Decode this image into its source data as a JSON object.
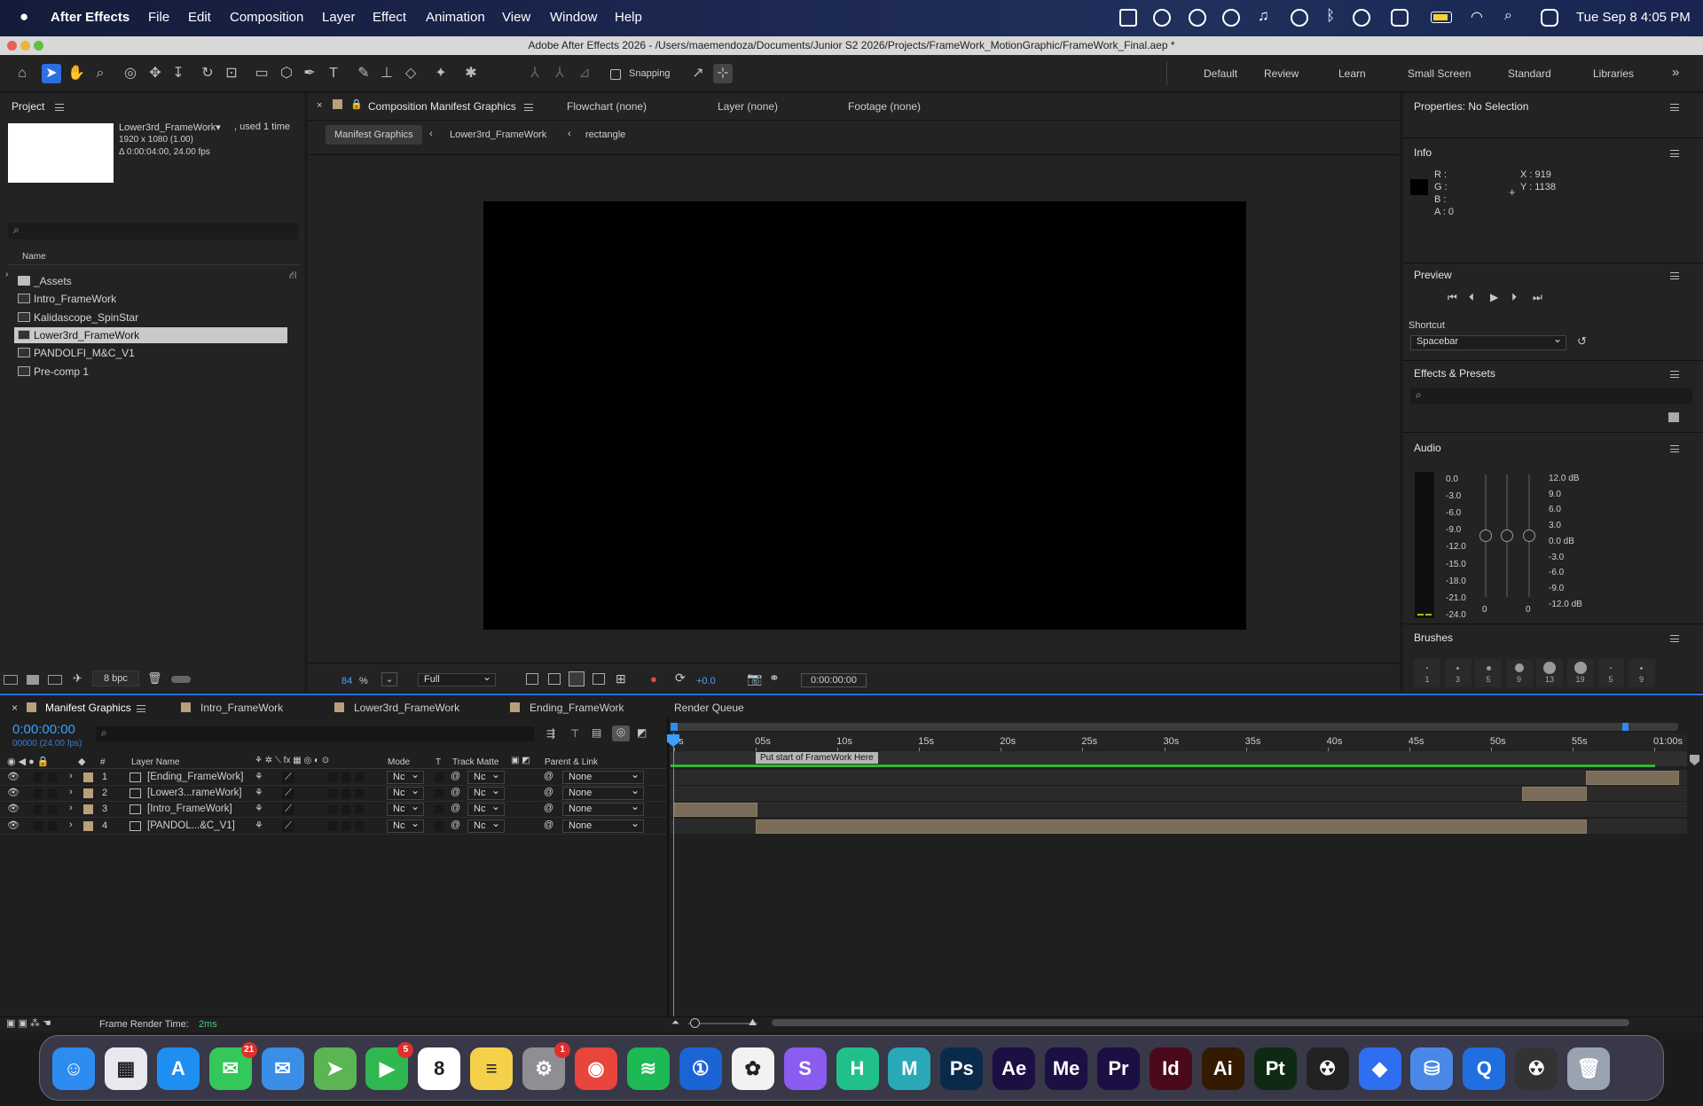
{
  "menubar": {
    "apple": "",
    "app": "After Effects",
    "items": [
      "File",
      "Edit",
      "Composition",
      "Layer",
      "Effect",
      "Animation",
      "View",
      "Window",
      "Help"
    ],
    "clock": "Tue Sep 8  4:05 PM"
  },
  "window": {
    "title": "Adobe After Effects 2026 - /Users/maemendoza/Documents/Junior S2 2026/Projects/FrameWork_MotionGraphic/FrameWork_Final.aep *"
  },
  "toolbar": {
    "snapping": "Snapping",
    "workspaces": [
      "Default",
      "Review",
      "Learn",
      "Small Screen",
      "Standard",
      "Libraries"
    ],
    "more": "»"
  },
  "project": {
    "title": "Project",
    "selected_name": "Lower3rd_FrameWork▾",
    "used": ", used 1 time",
    "size": "1920 x 1080 (1.00)",
    "duration": "Δ 0:00:04:00, 24.00 fps",
    "search_placeholder": "",
    "column_name": "Name",
    "items": [
      {
        "name": "_Assets",
        "type": "folder"
      },
      {
        "name": "Intro_FrameWork",
        "type": "comp"
      },
      {
        "name": "Kalidascope_SpinStar",
        "type": "comp"
      },
      {
        "name": "Lower3rd_FrameWork",
        "type": "comp",
        "selected": true
      },
      {
        "name": "PANDOLFI_M&C_V1",
        "type": "comp"
      },
      {
        "name": "Pre-comp 1",
        "type": "comp"
      }
    ],
    "bpc": "8 bpc"
  },
  "viewer": {
    "tab_label": "Composition Manifest Graphics",
    "other_tabs": [
      "Flowchart (none)",
      "Layer (none)",
      "Footage (none)"
    ],
    "breadcrumbs": [
      "Manifest Graphics",
      "Lower3rd_FrameWork",
      "rectangle"
    ],
    "zoom": "84",
    "zoom_unit": "%",
    "resolution": "Full",
    "exposure": "+0.0",
    "timecode": "0:00:00:00"
  },
  "properties": {
    "title": "Properties: No Selection"
  },
  "info": {
    "title": "Info",
    "r": "R :",
    "g": "G :",
    "b": "B :",
    "a": "A :  0",
    "x": "X :  919",
    "y": "Y :  1138"
  },
  "preview": {
    "title": "Preview",
    "shortcut_label": "Shortcut",
    "shortcut_value": "Spacebar"
  },
  "effects": {
    "title": "Effects & Presets"
  },
  "audio": {
    "title": "Audio",
    "left_scale": [
      "0.0",
      "-3.0",
      "-6.0",
      "-9.0",
      "-12.0",
      "-15.0",
      "-18.0",
      "-21.0",
      "-24.0"
    ],
    "right_scale": [
      "12.0 dB",
      "9.0",
      "6.0",
      "3.0",
      "0.0 dB",
      "-3.0",
      "-6.0",
      "-9.0",
      "-12.0 dB"
    ],
    "zero_a": "0",
    "zero_b": "0"
  },
  "brushes": {
    "title": "Brushes",
    "sizes": [
      "1",
      "3",
      "5",
      "9",
      "13",
      "19",
      "5",
      "9"
    ]
  },
  "timeline": {
    "tabs": [
      "Manifest Graphics",
      "Intro_FrameWork",
      "Lower3rd_FrameWork",
      "Ending_FrameWork",
      "Render Queue"
    ],
    "timecode": "0:00:00:00",
    "frames": "00000 (24.00 fps)",
    "columns": {
      "num": "#",
      "layer_name": "Layer Name",
      "mode": "Mode",
      "t": "T",
      "track_matte": "Track Matte",
      "parent": "Parent & Link"
    },
    "ruler": [
      "0s",
      "05s",
      "10s",
      "15s",
      "20s",
      "25s",
      "30s",
      "35s",
      "40s",
      "45s",
      "50s",
      "55s",
      "01:00s"
    ],
    "marker": "Put start of FrameWork Here",
    "layers": [
      {
        "num": "1",
        "name": "[Ending_FrameWork]",
        "mode": "Nc",
        "matte": "Nc",
        "parent": "None",
        "start": 55.8,
        "end": 61.5
      },
      {
        "num": "2",
        "name": "[Lower3...rameWork]",
        "mode": "Nc",
        "matte": "Nc",
        "parent": "None",
        "start": 51.9,
        "end": 55.9
      },
      {
        "num": "3",
        "name": "[Intro_FrameWork]",
        "mode": "Nc",
        "matte": "Nc",
        "parent": "None",
        "start": 0.0,
        "end": 5.1
      },
      {
        "num": "4",
        "name": "[PANDOL...&C_V1]",
        "mode": "Nc",
        "matte": "Nc",
        "parent": "None",
        "start": 5.0,
        "end": 55.9
      }
    ],
    "render_time_label": "Frame Render Time:",
    "render_time_value": "2ms"
  },
  "dock": {
    "apps": [
      {
        "name": "Finder",
        "glyph": "☺",
        "color": "#2d8cf0"
      },
      {
        "name": "Launchpad",
        "glyph": "▦",
        "color": "#e8e8ee"
      },
      {
        "name": "App Store",
        "glyph": "A",
        "color": "#1f8ef1"
      },
      {
        "name": "Messages",
        "glyph": "✉",
        "color": "#34c759",
        "badge": "21"
      },
      {
        "name": "Mail",
        "glyph": "✉",
        "color": "#3a8ee6"
      },
      {
        "name": "Maps",
        "glyph": "➤",
        "color": "#5ab552"
      },
      {
        "name": "FaceTime",
        "glyph": "▶",
        "color": "#2fb850",
        "badge": "5"
      },
      {
        "name": "Calendar",
        "glyph": "8",
        "color": "#ffffff"
      },
      {
        "name": "Notes",
        "glyph": "≡",
        "color": "#f5d14a"
      },
      {
        "name": "System Settings",
        "glyph": "⚙",
        "color": "#8e8e93",
        "badge": "1"
      },
      {
        "name": "Chrome",
        "glyph": "◉",
        "color": "#e8453c"
      },
      {
        "name": "Spotify",
        "glyph": "≋",
        "color": "#1db954"
      },
      {
        "name": "1Password",
        "glyph": "①",
        "color": "#1a64d6"
      },
      {
        "name": "Photos",
        "glyph": "✿",
        "color": "#f2f2f2"
      },
      {
        "name": "S App",
        "glyph": "S",
        "color": "#8a5cf0"
      },
      {
        "name": "H App",
        "glyph": "H",
        "color": "#21c08b"
      },
      {
        "name": "Maya",
        "glyph": "M",
        "color": "#29a8b8"
      },
      {
        "name": "Photoshop",
        "glyph": "Ps",
        "color": "#0a2a4a"
      },
      {
        "name": "After Effects",
        "glyph": "Ae",
        "color": "#1c0f44"
      },
      {
        "name": "Media Encoder",
        "glyph": "Me",
        "color": "#1c0f44"
      },
      {
        "name": "Premiere Pro",
        "glyph": "Pr",
        "color": "#1c0f44"
      },
      {
        "name": "InDesign",
        "glyph": "Id",
        "color": "#4a0a1c"
      },
      {
        "name": "Illustrator",
        "glyph": "Ai",
        "color": "#331a00"
      },
      {
        "name": "Substance Painter",
        "glyph": "Pt",
        "color": "#0f2a12"
      },
      {
        "name": "Nuke",
        "glyph": "☢",
        "color": "#222222"
      },
      {
        "name": "Box App",
        "glyph": "◆",
        "color": "#2d6ff0"
      },
      {
        "name": "Disk Utility",
        "glyph": "⛁",
        "color": "#4a88e8"
      },
      {
        "name": "QuickTime",
        "glyph": "Q",
        "color": "#1f6fe0"
      },
      {
        "name": "Nuke 2",
        "glyph": "☢",
        "color": "#333333"
      },
      {
        "name": "Trash",
        "glyph": "🗑",
        "color": "#9aa3b0"
      }
    ]
  },
  "colors": {
    "accent": "#2d6fe0",
    "label_swatch": "#b8a07a",
    "layer_bar": "#7a6c58",
    "timecode": "#3aa0ff"
  }
}
